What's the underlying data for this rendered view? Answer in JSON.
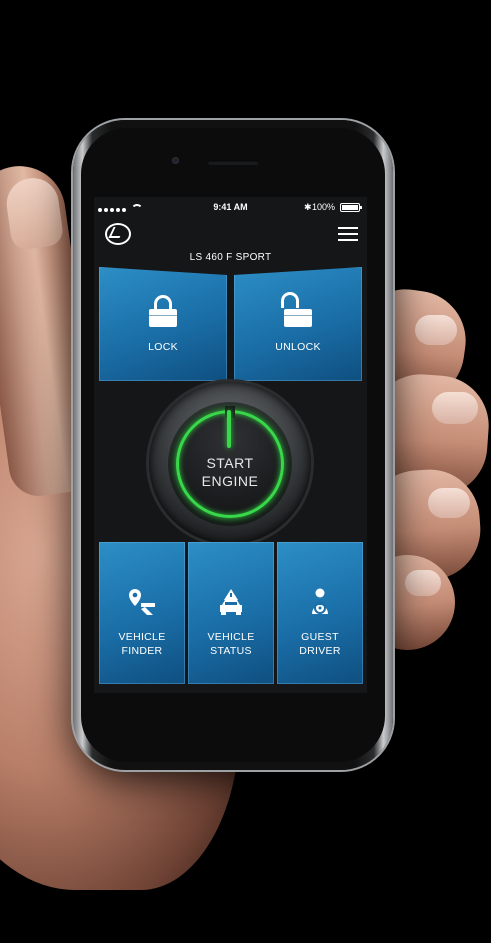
{
  "status_bar": {
    "time": "9:41 AM",
    "battery": "100%",
    "bluetooth": "✱"
  },
  "app": {
    "vehicle_name": "LS 460 F SPORT"
  },
  "actions": {
    "lock": "LOCK",
    "unlock": "UNLOCK",
    "start_line1": "START",
    "start_line2": "ENGINE",
    "vehicle_finder_1": "VEHICLE",
    "vehicle_finder_2": "FINDER",
    "vehicle_status_1": "VEHICLE",
    "vehicle_status_2": "STATUS",
    "guest_driver_1": "GUEST",
    "guest_driver_2": "DRIVER"
  },
  "colors": {
    "tile_blue": "#1a6ea7",
    "engine_green": "#39d84a",
    "background": "#000000"
  },
  "icons": [
    "logo-icon",
    "menu-icon",
    "lock-icon",
    "unlock-icon",
    "power-icon",
    "location-pin-icon",
    "car-warning-icon",
    "driver-steering-icon"
  ]
}
